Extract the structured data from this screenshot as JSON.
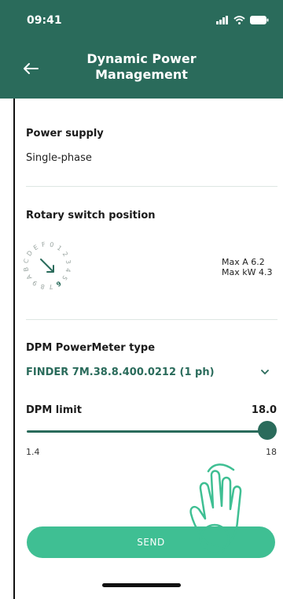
{
  "status_bar": {
    "time": "09:41"
  },
  "header": {
    "title_line1": "Dynamic Power",
    "title_line2": "Management"
  },
  "power_supply": {
    "label": "Power supply",
    "value": "Single-phase"
  },
  "rotary": {
    "label": "Rotary switch position",
    "dial_chars": [
      "F",
      "0",
      "1",
      "2",
      "3",
      "4",
      "5",
      "6",
      "7",
      "8",
      "9",
      "A",
      "B",
      "C",
      "D",
      "E"
    ],
    "selected": "6",
    "max_a": "Max A 6.2",
    "max_kw": "Max kW 4.3"
  },
  "powermeter": {
    "label": "DPM PowerMeter type",
    "selected": "FINDER 7M.38.8.400.0212 (1 ph)"
  },
  "dpm_limit": {
    "label": "DPM limit",
    "value": "18.0",
    "min": "1.4",
    "max": "18",
    "fill_fraction": 1.0
  },
  "send_button": {
    "label": "SEND"
  },
  "colors": {
    "primary": "#2a6b5b",
    "accent": "#3fbf93"
  }
}
